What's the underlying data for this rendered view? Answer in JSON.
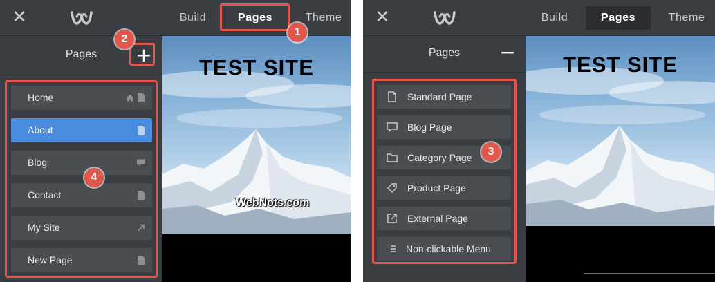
{
  "left": {
    "topbar": {
      "close": "✕",
      "tabs": [
        "Build",
        "Pages",
        "Theme"
      ]
    },
    "sidebar": {
      "title": "Pages",
      "action": "+",
      "items": [
        {
          "label": "Home",
          "icons": [
            "home-icon",
            "page-icon"
          ]
        },
        {
          "label": "About",
          "icons": [
            "page-icon"
          ],
          "selected": true
        },
        {
          "label": "Blog",
          "icons": [
            "comment-icon"
          ]
        },
        {
          "label": "Contact",
          "icons": [
            "page-icon"
          ]
        },
        {
          "label": "My Site",
          "icons": [
            "external-arrow-icon"
          ]
        },
        {
          "label": "New Page",
          "icons": [
            "page-icon"
          ]
        }
      ]
    },
    "preview": {
      "title": "TEST SITE",
      "watermark": "WebNots.com"
    },
    "badges": [
      "1",
      "2",
      "4"
    ]
  },
  "right": {
    "topbar": {
      "close": "✕",
      "tabs": [
        "Build",
        "Pages",
        "Theme"
      ]
    },
    "sidebar": {
      "title": "Pages",
      "action": "−",
      "page_types": [
        {
          "label": "Standard Page",
          "icon": "page-icon"
        },
        {
          "label": "Blog Page",
          "icon": "comment-icon"
        },
        {
          "label": "Category Page",
          "icon": "folder-icon"
        },
        {
          "label": "Product Page",
          "icon": "tag-icon"
        },
        {
          "label": "External Page",
          "icon": "external-link-icon"
        },
        {
          "label": "Non-clickable Menu",
          "icon": "list-icon"
        }
      ]
    },
    "preview": {
      "title": "TEST SITE"
    },
    "badges": [
      "3"
    ]
  },
  "colors": {
    "accent": "#e2574c",
    "selected": "#4a8de0",
    "chrome": "#3a3d41"
  }
}
